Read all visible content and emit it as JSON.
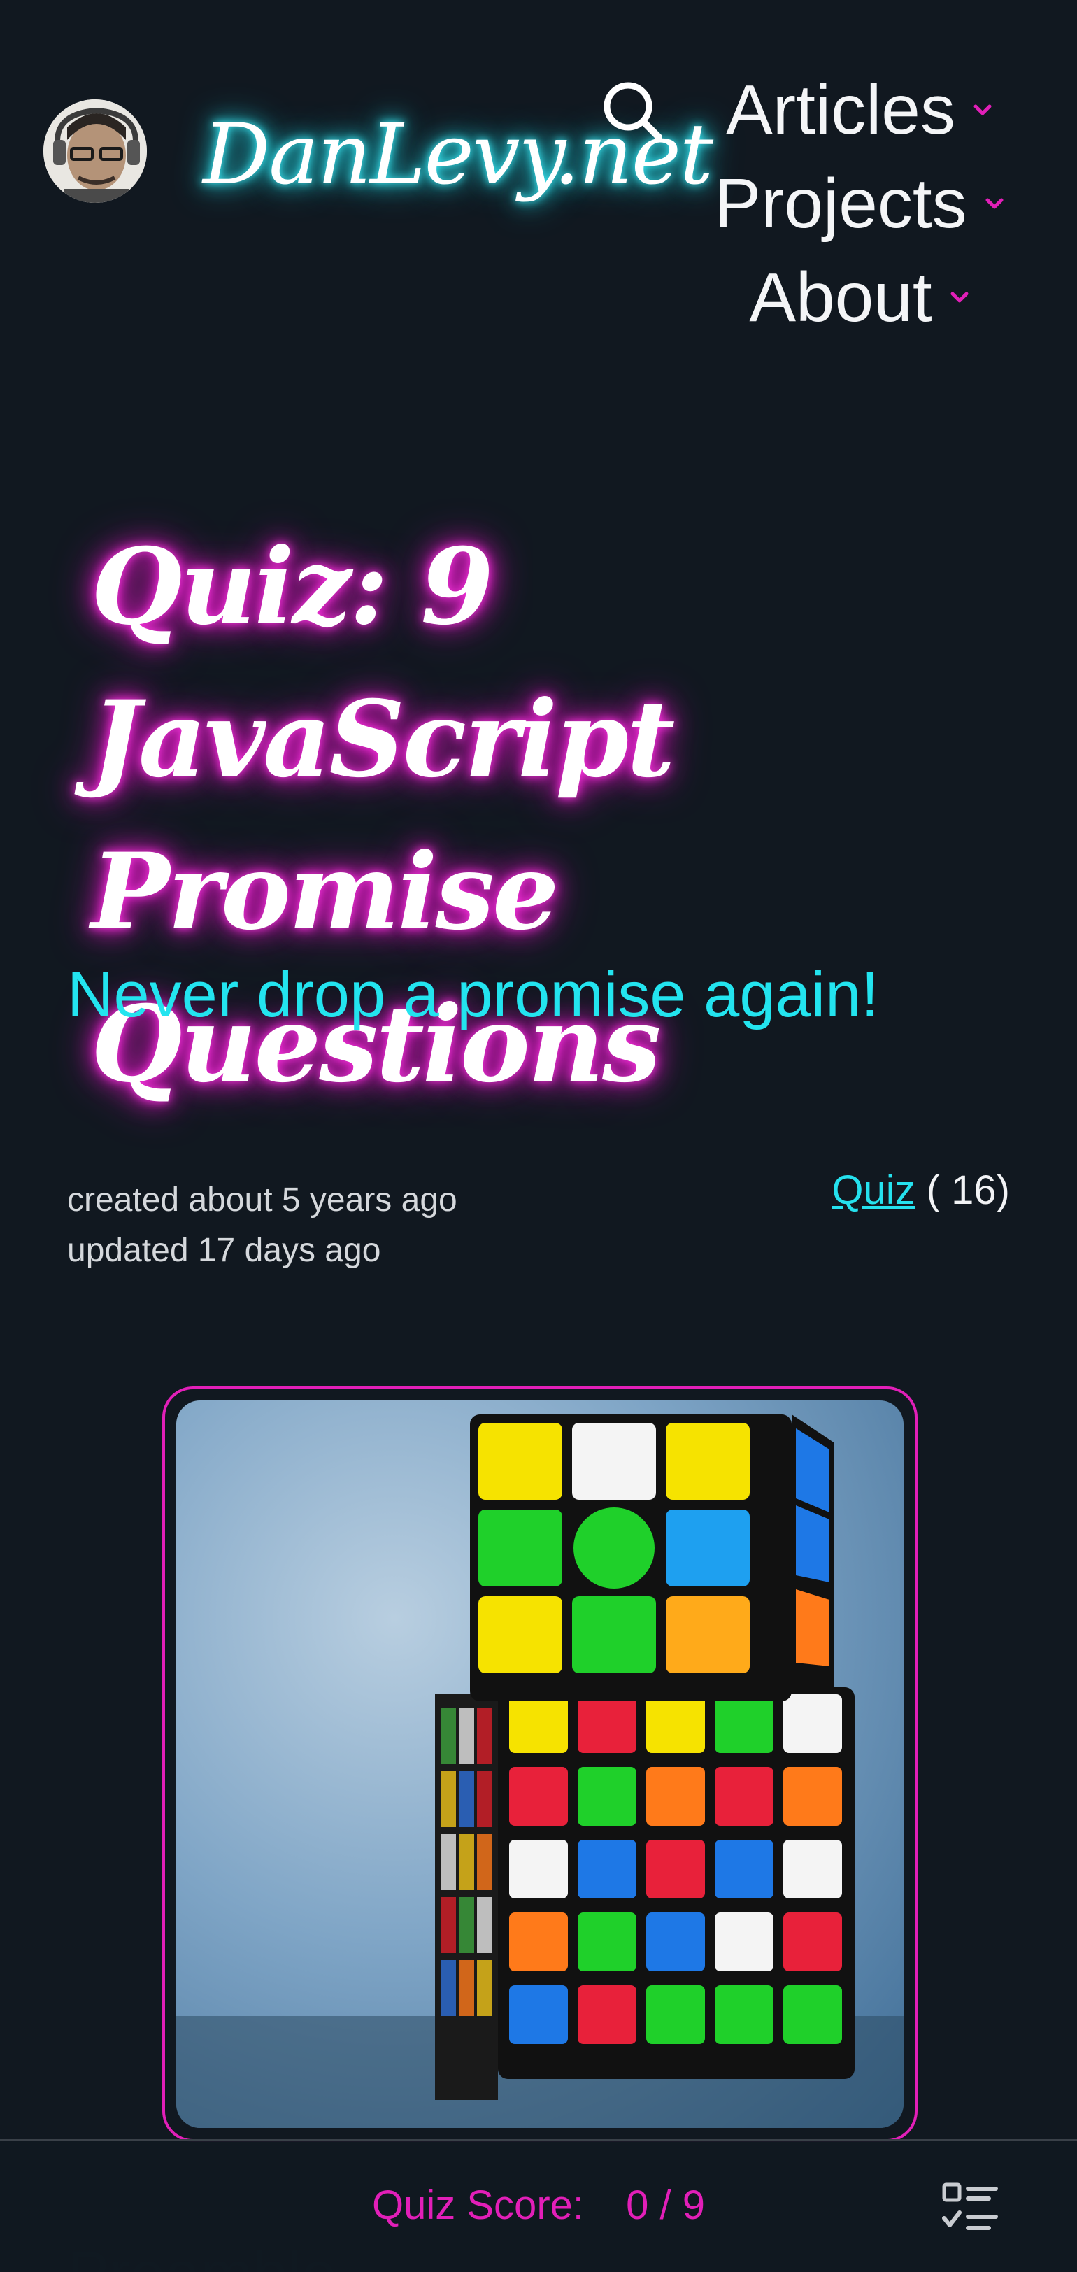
{
  "header": {
    "logo_text": "DanLevy.net",
    "avatar_icon": "avatar-photo",
    "search_icon": "search-icon",
    "nav": [
      {
        "label": "Articles",
        "icon": "chevron-down-icon"
      },
      {
        "label": "Projects",
        "icon": "chevron-down-icon"
      },
      {
        "label": "About",
        "icon": "chevron-down-icon"
      }
    ]
  },
  "article": {
    "title_line1": "Quiz: 9 JavaScript",
    "title_line2": "Promise Questions",
    "subtitle": "Never drop a promise again!",
    "created": "created about 5 years ago",
    "updated": "updated 17 days ago",
    "tag_label": "Quiz",
    "tag_count": "( 16)",
    "hero_alt": "Stack of Rubik's cubes"
  },
  "quiz_bar": {
    "score_label": "Quiz Score:",
    "score_value": "0 / 9",
    "toc_icon": "list-check-icon"
  },
  "colors": {
    "background": "#111820",
    "accent_cyan": "#25e1ee",
    "accent_magenta": "#e21fb8",
    "text": "#f2f3f5"
  }
}
